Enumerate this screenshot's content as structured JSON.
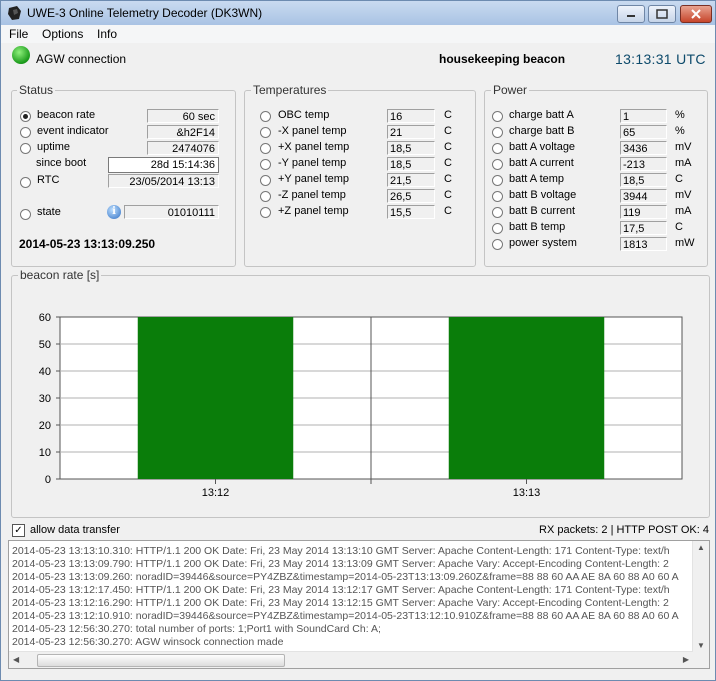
{
  "window": {
    "title": "UWE-3 Online Telemetry Decoder (DK3WN)"
  },
  "menu": [
    "File",
    "Options",
    "Info"
  ],
  "header": {
    "connection_label": "AGW connection",
    "beacon_label": "housekeeping beacon",
    "clock": "13:13:31 UTC"
  },
  "status": {
    "title": "Status",
    "items": [
      {
        "label": "beacon rate",
        "value": "60 sec",
        "selected": true
      },
      {
        "label": "event indicator",
        "value": "&h2F14",
        "selected": false
      },
      {
        "label": "uptime",
        "value": "2474076",
        "selected": false
      }
    ],
    "since_boot_label": "since boot",
    "since_boot_value": "28d 15:14:36",
    "rtc_label": "RTC",
    "rtc_value": "23/05/2014 13:13",
    "state_label": "state",
    "state_value": "01010111",
    "info_glyph": "i",
    "timestamp": "2014-05-23 13:13:09.250"
  },
  "temperatures": {
    "title": "Temperatures",
    "items": [
      {
        "label": "OBC temp",
        "value": "16",
        "unit": "C"
      },
      {
        "label": "-X panel temp",
        "value": "21",
        "unit": "C"
      },
      {
        "label": "+X panel temp",
        "value": "18,5",
        "unit": "C"
      },
      {
        "label": "-Y panel temp",
        "value": "18,5",
        "unit": "C"
      },
      {
        "label": "+Y panel temp",
        "value": "21,5",
        "unit": "C"
      },
      {
        "label": "-Z panel temp",
        "value": "26,5",
        "unit": "C"
      },
      {
        "label": "+Z panel temp",
        "value": "15,5",
        "unit": "C"
      }
    ]
  },
  "power": {
    "title": "Power",
    "items": [
      {
        "label": "charge batt A",
        "value": "1",
        "unit": "%"
      },
      {
        "label": "charge batt B",
        "value": "65",
        "unit": "%"
      },
      {
        "label": "batt A voltage",
        "value": "3436",
        "unit": "mV"
      },
      {
        "label": "batt A current",
        "value": "-213",
        "unit": "mA"
      },
      {
        "label": "batt A temp",
        "value": "18,5",
        "unit": "C"
      },
      {
        "label": "batt B voltage",
        "value": "3944",
        "unit": "mV"
      },
      {
        "label": "batt B current",
        "value": "119",
        "unit": "mA"
      },
      {
        "label": "batt B temp",
        "value": "17,5",
        "unit": "C"
      },
      {
        "label": "power system",
        "value": "1813",
        "unit": "mW"
      }
    ]
  },
  "chart_panel": {
    "title": "beacon rate [s]"
  },
  "chart_data": {
    "type": "bar",
    "categories": [
      "13:12",
      "13:13"
    ],
    "values": [
      60,
      60
    ],
    "ylim": [
      0,
      60
    ],
    "yticks": [
      "0",
      "10",
      "20",
      "30",
      "40",
      "50",
      "60"
    ],
    "grid": true,
    "bar_color": "#0a7d0a"
  },
  "footer": {
    "allow_label": "allow data transfer",
    "allow_checked": true,
    "rx_status": "RX packets: 2 | HTTP POST OK: 4"
  },
  "log": [
    "2014-05-23 13:13:10.310: HTTP/1.1 200 OK Date: Fri, 23 May 2014 13:13:10 GMT Server: Apache Content-Length: 171 Content-Type: text/h",
    "2014-05-23 13:13:09.790: HTTP/1.1 200 OK Date: Fri, 23 May 2014 13:13:09 GMT Server: Apache Vary: Accept-Encoding Content-Length: 2",
    "2014-05-23 13:13:09.260: noradID=39446&source=PY4ZBZ&timestamp=2014-05-23T13:13:09.260Z&frame=88 88 60 AA AE 8A 60 88 A0 60 A",
    "2014-05-23 13:12:17.450: HTTP/1.1 200 OK Date: Fri, 23 May 2014 13:12:17 GMT Server: Apache Content-Length: 171 Content-Type: text/h",
    "2014-05-23 13:12:16.290: HTTP/1.1 200 OK Date: Fri, 23 May 2014 13:12:15 GMT Server: Apache Vary: Accept-Encoding Content-Length: 2",
    "2014-05-23 13:12:10.910: noradID=39446&source=PY4ZBZ&timestamp=2014-05-23T13:12:10.910Z&frame=88 88 60 AA AE 8A 60 88 A0 60 A",
    "2014-05-23 12:56:30.270: total number of ports: 1;Port1 with SoundCard Ch: A;",
    "2014-05-23 12:56:30.270: AGW winsock connection made"
  ]
}
